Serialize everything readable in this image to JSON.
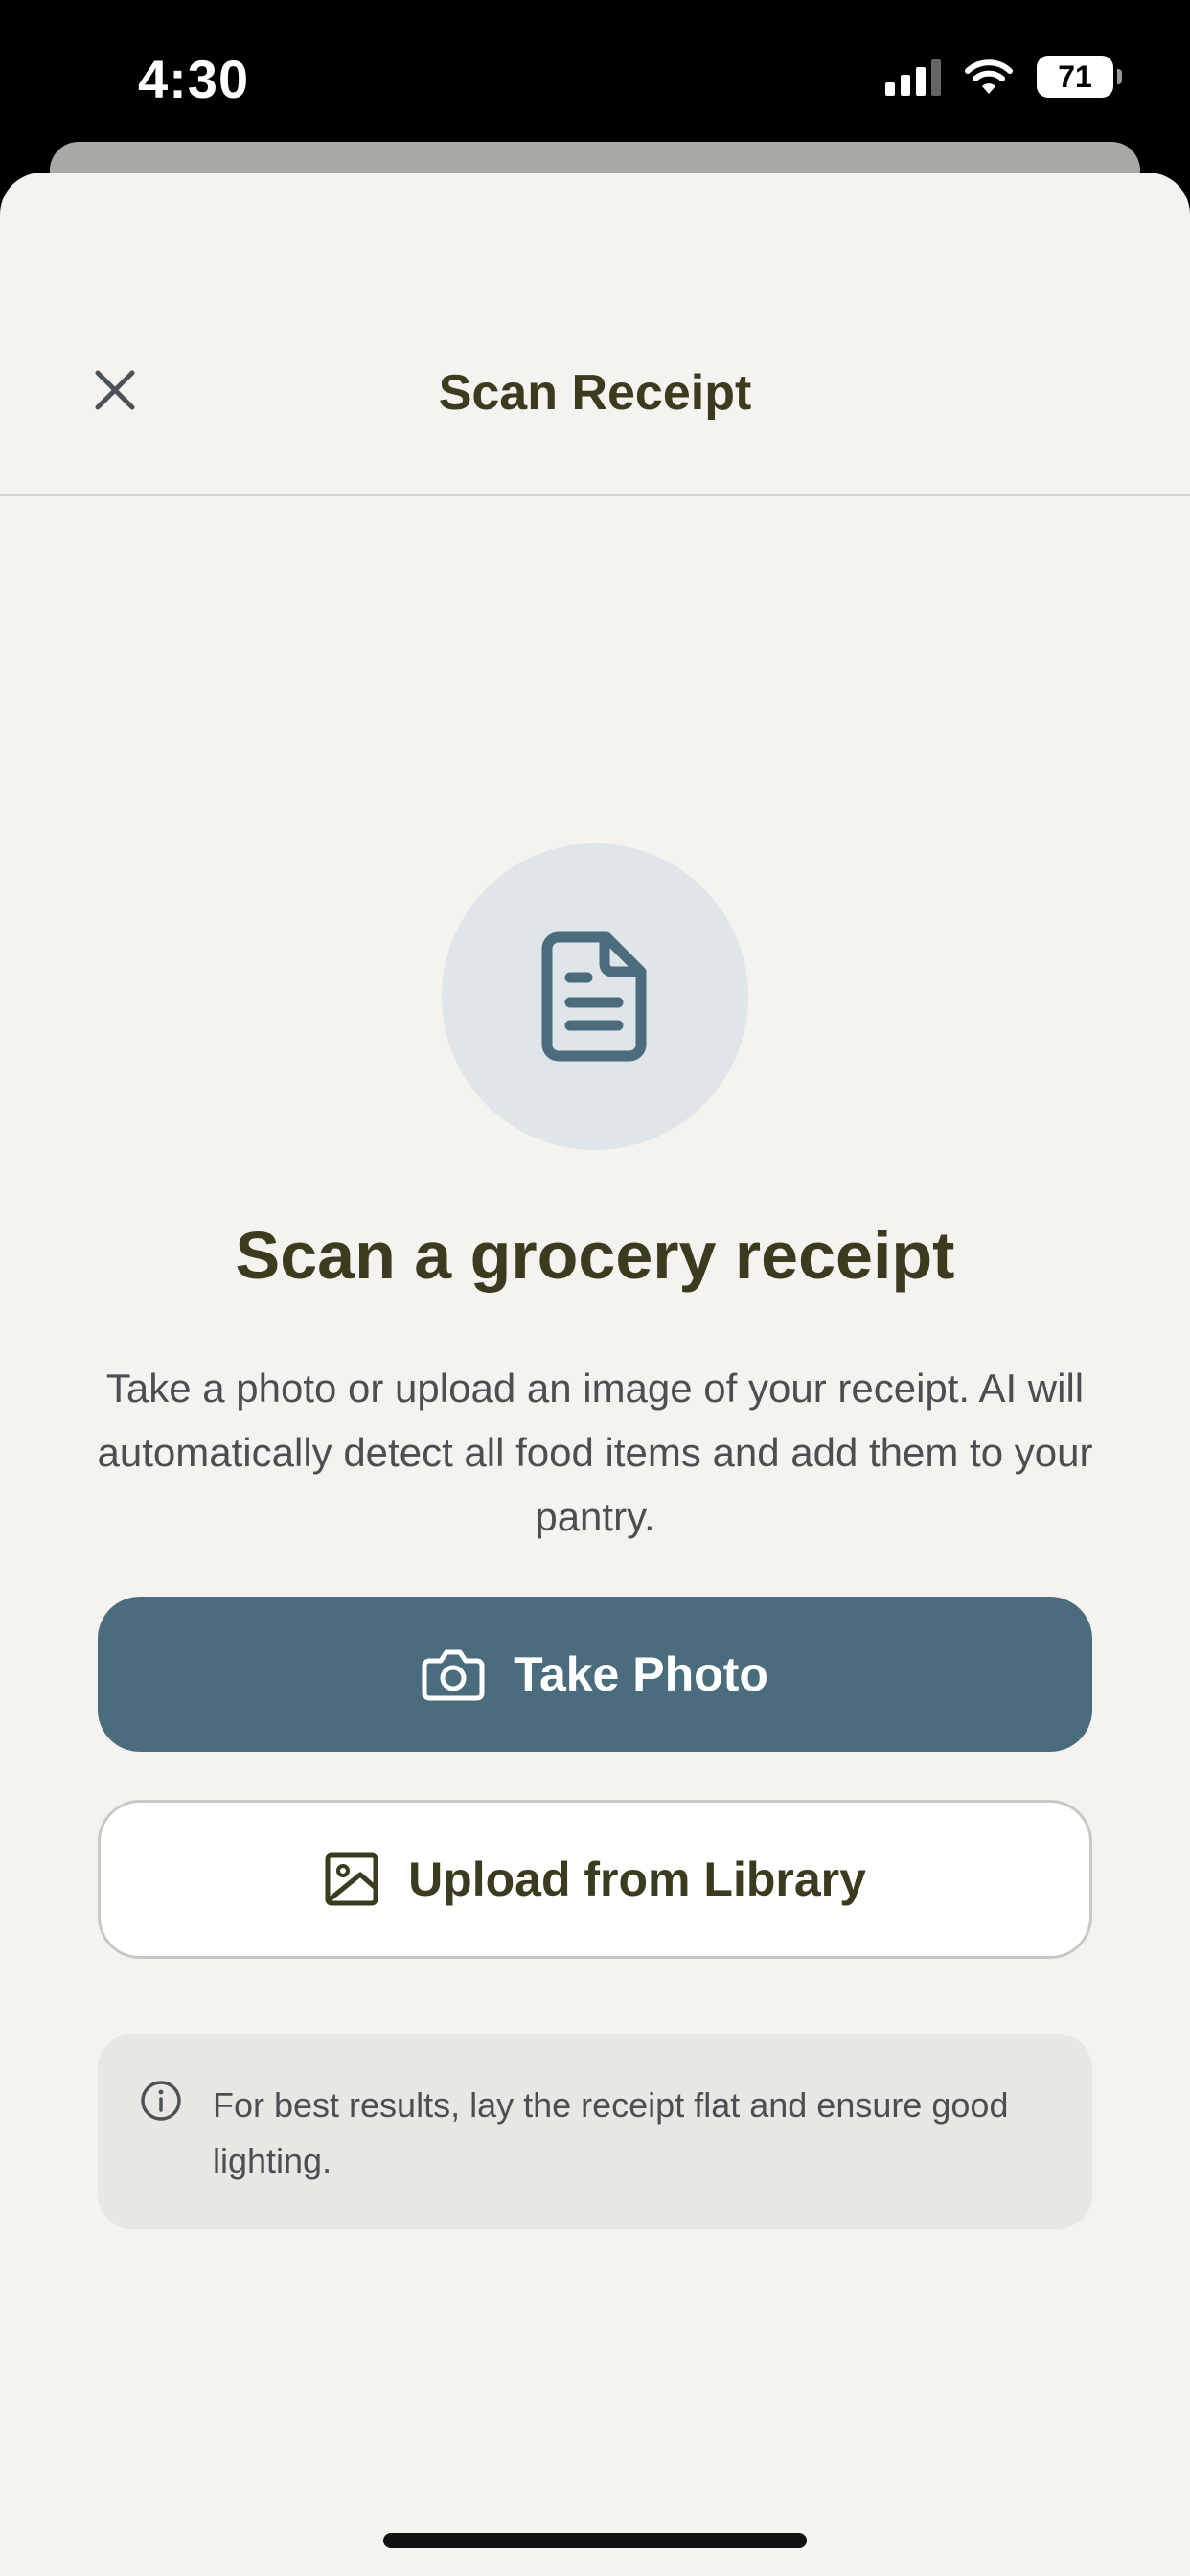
{
  "status_bar": {
    "time": "4:30",
    "battery": "71"
  },
  "header": {
    "title": "Scan Receipt",
    "close_icon": "close-icon"
  },
  "hero": {
    "icon": "document-icon",
    "heading": "Scan a grocery receipt",
    "description": "Take a photo or upload an image of your receipt. AI will automatically detect all food items and add them to your pantry."
  },
  "actions": {
    "take_photo_label": "Take Photo",
    "take_photo_icon": "camera-icon",
    "upload_label": "Upload from Library",
    "upload_icon": "image-icon"
  },
  "tip": {
    "icon": "info-icon",
    "text": "For best results, lay the receipt flat and ensure good lighting."
  },
  "colors": {
    "primary": "#4a6c7c",
    "heading": "#3a3b1f",
    "background": "#f5f3ef",
    "icon_circle": "#dfe5e8",
    "tip_background": "#e8e7e3"
  }
}
